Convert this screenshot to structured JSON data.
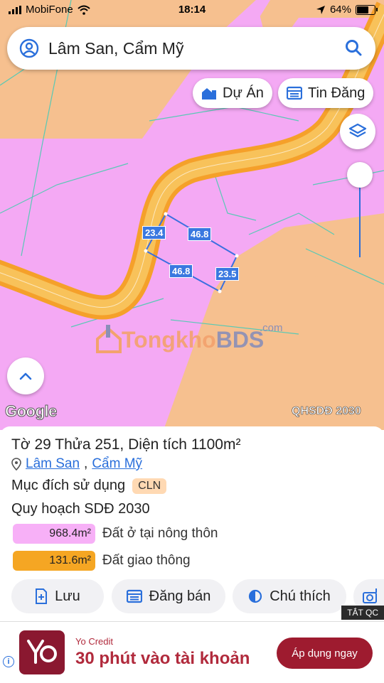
{
  "status_bar": {
    "carrier": "MobiFone",
    "time": "18:14",
    "battery": "64%"
  },
  "search": {
    "text": "Lâm San, Cẩm Mỹ"
  },
  "chips": {
    "projects": "Dự Án",
    "listings": "Tin Đăng"
  },
  "map": {
    "dimensions": {
      "left": "23.4",
      "top": "46.8",
      "bottom": "46.8",
      "right": "23.5"
    },
    "watermark": {
      "part1": "Tongkho",
      "part2": "BDS",
      "suffix": ".com"
    },
    "google_logo": "Google",
    "layer_label": "QHSDĐ 2030"
  },
  "parcel": {
    "sheet_label": "Tờ",
    "sheet_no": "29",
    "plot_label": "Thửa",
    "plot_no": "251",
    "area_label": "Diện tích",
    "area_value": "1100m²",
    "commune": "Lâm San",
    "district": "Cẩm Mỹ",
    "purpose_label": "Mục đích sử dụng",
    "purpose_code": "CLN",
    "plan_label": "Quy hoạch SDĐ 2030",
    "legend": [
      {
        "area": "968.4m²",
        "label": "Đất ở tại nông thôn",
        "color": "#f7b0f7"
      },
      {
        "area": "131.6m²",
        "label": "Đất giao thông",
        "color": "#f5a623"
      }
    ]
  },
  "actions": {
    "save": "Lưu",
    "sell": "Đăng bán",
    "legend": "Chú thích"
  },
  "ad": {
    "tag": "TẮT QC",
    "brand": "Yo Credit",
    "headline": "30 phút vào tài khoản",
    "cta": "Áp dụng ngay"
  },
  "colors": {
    "residential": "#f4a9f4",
    "agri": "#f6c08f",
    "road": "#f5a02a",
    "accent": "#2a6fdb"
  }
}
